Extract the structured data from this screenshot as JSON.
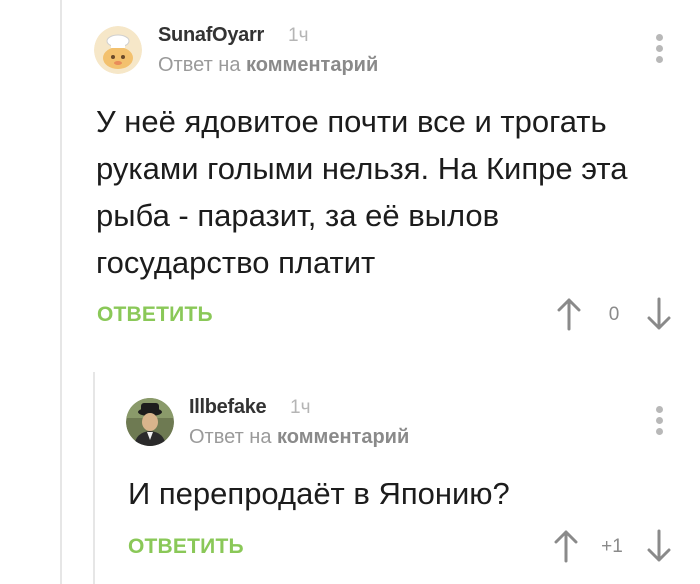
{
  "comments": [
    {
      "author": "SunafOyarr",
      "time": "1ч",
      "reply_prefix": "Ответ на",
      "reply_link": "комментарий",
      "text": "У неё ядовитое почти все и трогать руками голыми нельзя. На Кипре эта рыба - паразит, за её вылов государство платит",
      "reply_label": "ОТВЕТИТЬ",
      "score": "0"
    },
    {
      "author": "Illbefake",
      "time": "1ч",
      "reply_prefix": "Ответ на",
      "reply_link": "комментарий",
      "text": "И перепродаёт в Японию?",
      "reply_label": "ОТВЕТИТЬ",
      "score": "+1"
    }
  ],
  "icons": {
    "more": "more-vertical-icon",
    "upvote": "arrow-up-icon",
    "downvote": "arrow-down-icon"
  },
  "colors": {
    "reply_button": "#8ac858",
    "muted": "#9a9a9a",
    "text": "#1c1c1c"
  }
}
